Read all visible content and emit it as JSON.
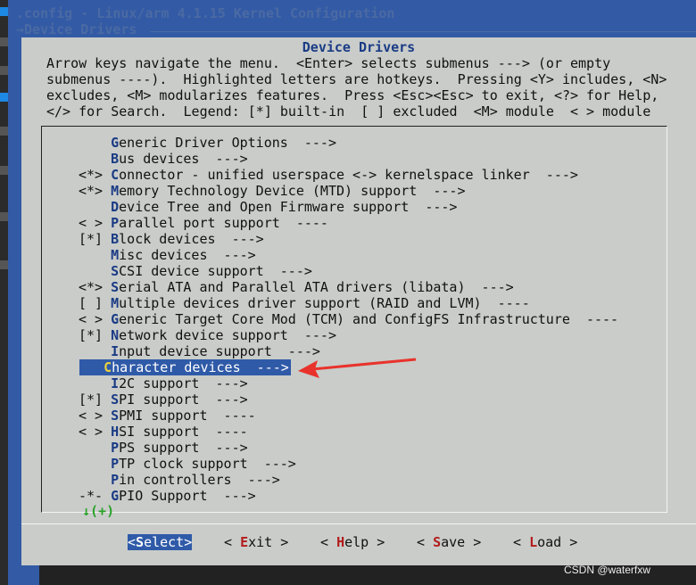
{
  "window": {
    "title": ".config - Linux/arm 4.1.15 Kernel Configuration",
    "breadcrumb": "→Device Drivers"
  },
  "dialog": {
    "title": "Device Drivers",
    "help_lines": [
      "Arrow keys navigate the menu.  <Enter> selects submenus ---> (or empty",
      "submenus ----).  Highlighted letters are hotkeys.  Pressing <Y> includes, <N>",
      "excludes, <M> modularizes features.  Press <Esc><Esc> to exit, <?> for Help,",
      "</> for Search.  Legend: [*] built-in  [ ] excluded  <M> module  < > module"
    ]
  },
  "menu": {
    "items": [
      {
        "prefix": "    ",
        "hotkey": "G",
        "rest": "eneric Driver Options  --->"
      },
      {
        "prefix": "    ",
        "hotkey": "B",
        "rest": "us devices  --->"
      },
      {
        "prefix": "<*> ",
        "hotkey": "C",
        "rest": "onnector - unified userspace <-> kernelspace linker  --->"
      },
      {
        "prefix": "<*> ",
        "hotkey": "M",
        "rest": "emory Technology Device (MTD) support  --->"
      },
      {
        "prefix": "    ",
        "hotkey": "D",
        "rest": "evice Tree and Open Firmware support  --->"
      },
      {
        "prefix": "< > ",
        "hotkey": "P",
        "rest": "arallel port support  ----"
      },
      {
        "prefix": "[*] ",
        "hotkey": "B",
        "rest": "lock devices  --->"
      },
      {
        "prefix": "    ",
        "hotkey": "M",
        "rest": "isc devices  --->"
      },
      {
        "prefix": "    ",
        "hotkey": "S",
        "rest": "CSI device support  --->"
      },
      {
        "prefix": "<*> ",
        "hotkey": "S",
        "rest": "erial ATA and Parallel ATA drivers (libata)  --->"
      },
      {
        "prefix": "[ ] ",
        "hotkey": "M",
        "rest": "ultiple devices driver support (RAID and LVM)  ----"
      },
      {
        "prefix": "< > ",
        "hotkey": "G",
        "rest": "eneric Target Core Mod (TCM) and ConfigFS Infrastructure  ----"
      },
      {
        "prefix": "[*] ",
        "hotkey": "N",
        "rest": "etwork device support  --->"
      },
      {
        "prefix": "    ",
        "hotkey": "I",
        "rest": "nput device support  --->"
      },
      {
        "prefix": "    ",
        "hotkey": "C",
        "rest": "haracter devices  --->",
        "selected": true
      },
      {
        "prefix": "    ",
        "hotkey": "I",
        "rest": "2C support  --->"
      },
      {
        "prefix": "[*] ",
        "hotkey": "S",
        "rest": "PI support  --->"
      },
      {
        "prefix": "< > ",
        "hotkey": "S",
        "rest": "PMI support  ----"
      },
      {
        "prefix": "< > ",
        "hotkey": "H",
        "rest": "SI support  ----"
      },
      {
        "prefix": "    ",
        "hotkey": "P",
        "rest": "PS support  --->"
      },
      {
        "prefix": "    ",
        "hotkey": "P",
        "rest": "TP clock support  --->"
      },
      {
        "prefix": "    ",
        "hotkey": "P",
        "rest": "in controllers  --->"
      },
      {
        "prefix": "-*- ",
        "hotkey": "G",
        "rest": "PIO Support  --->"
      }
    ],
    "more_indicator": "↓(+)"
  },
  "buttons": [
    {
      "open": "<",
      "hotkey": "S",
      "rest": "elect",
      "close": ">",
      "active": true
    },
    {
      "open": "< ",
      "hotkey": "E",
      "rest": "xit",
      "close": " >"
    },
    {
      "open": "< ",
      "hotkey": "H",
      "rest": "elp",
      "close": " >"
    },
    {
      "open": "< ",
      "hotkey": "S",
      "rest": "ave",
      "close": " >"
    },
    {
      "open": "< ",
      "hotkey": "L",
      "rest": "oad",
      "close": " >"
    }
  ],
  "watermark": "CSDN @waterfxw",
  "colors": {
    "background": "#335aa5",
    "dialog": "#c9ccc9",
    "hotkey_menu": "#1a3b85",
    "hotkey_button": "#b31b1b",
    "highlight": "#2f5aa8",
    "annotation_arrow": "#e8332c",
    "more_indicator": "#2aa12a"
  }
}
